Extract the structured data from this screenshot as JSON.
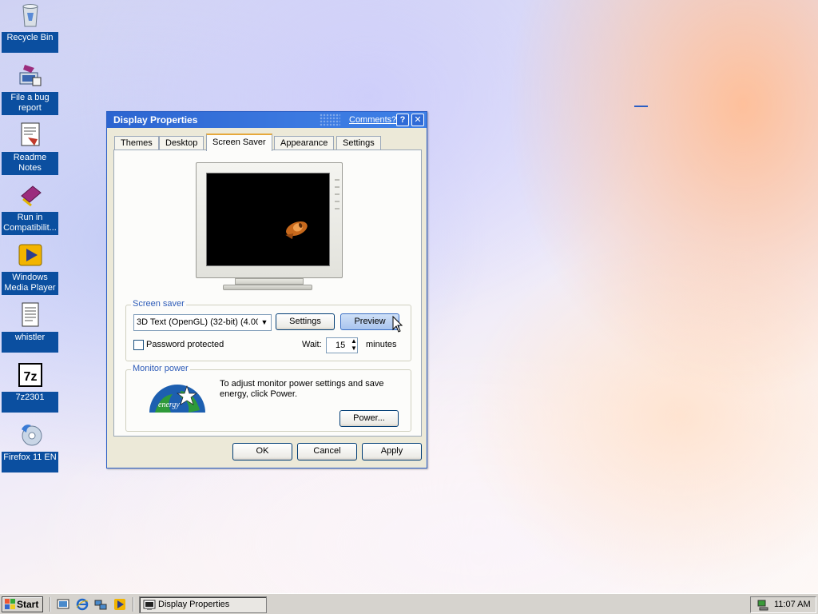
{
  "desktop": {
    "icons": [
      {
        "label": "Recycle Bin",
        "icon": "recycle-bin-icon"
      },
      {
        "label": "File a bug report",
        "icon": "bug-report-icon"
      },
      {
        "label": "Readme Notes",
        "icon": "readme-notes-icon"
      },
      {
        "label": "Run in Compatibilit...",
        "icon": "compatibility-icon"
      },
      {
        "label": "Windows Media Player",
        "icon": "media-player-icon"
      },
      {
        "label": "whistler",
        "icon": "text-file-icon"
      },
      {
        "label": "7z2301",
        "icon": "7zip-icon"
      },
      {
        "label": "Firefox 11 EN",
        "icon": "firefox-installer-icon"
      }
    ]
  },
  "dialog": {
    "title": "Display Properties",
    "comments_link": "Comments?",
    "help_button": "?",
    "close_button": "✕",
    "tabs": [
      {
        "label": "Themes",
        "active": false
      },
      {
        "label": "Desktop",
        "active": false
      },
      {
        "label": "Screen Saver",
        "active": true
      },
      {
        "label": "Appearance",
        "active": false
      },
      {
        "label": "Settings",
        "active": false
      }
    ],
    "screen_saver_group": {
      "title": "Screen saver",
      "selected": "3D Text (OpenGL) (32-bit) (4.00",
      "settings_button": "Settings",
      "preview_button": "Preview",
      "password_label": "Password protected",
      "password_checked": false,
      "wait_label": "Wait:",
      "wait_value": "15",
      "minutes_label": "minutes"
    },
    "monitor_power_group": {
      "title": "Monitor power",
      "description": "To adjust monitor power settings and save energy, click Power.",
      "power_button": "Power...",
      "logo_text": "energy"
    },
    "buttons": {
      "ok": "OK",
      "cancel": "Cancel",
      "apply": "Apply"
    }
  },
  "taskbar": {
    "start_label": "Start",
    "quick_launch": [
      "show-desktop-icon",
      "internet-explorer-icon",
      "network-icon",
      "media-player-icon"
    ],
    "task_button": "Display Properties",
    "clock": "11:07 AM"
  },
  "colors": {
    "title_bar": "#2c64d0",
    "dialog_bg": "#ece9d8",
    "group_title": "#2e5cb8",
    "desktop_label_bg": "#0b4fa0"
  }
}
